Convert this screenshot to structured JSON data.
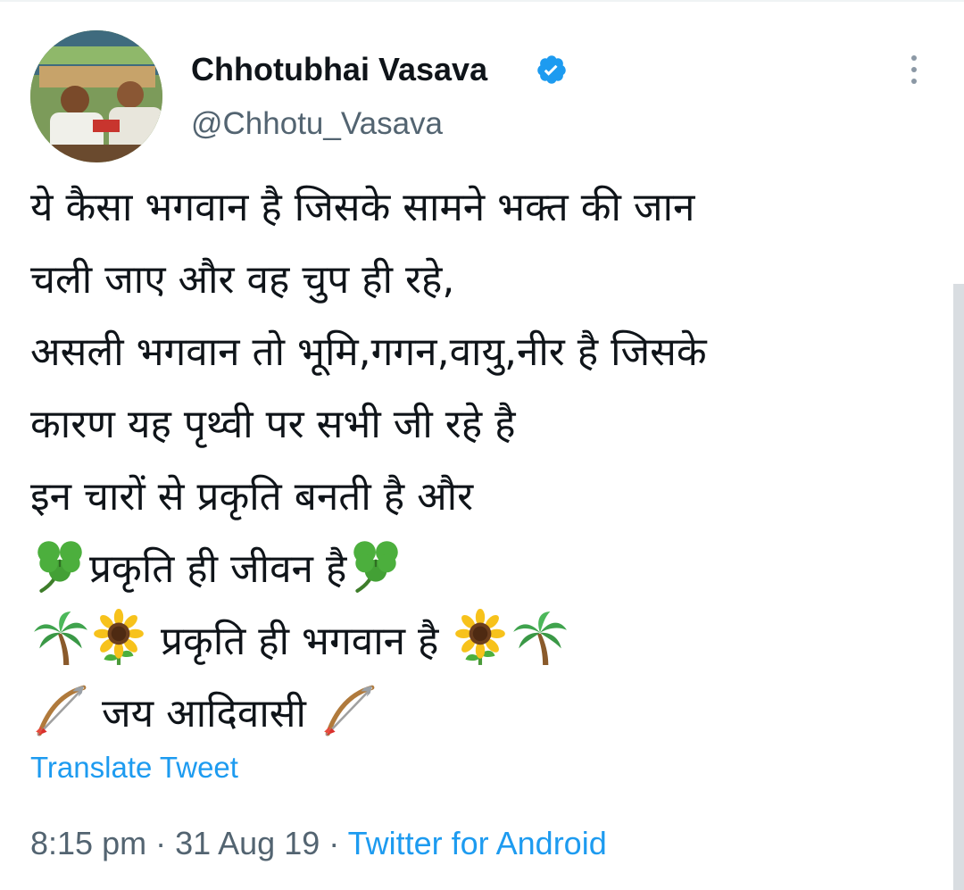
{
  "author": {
    "display_name": "Chhotubhai Vasava",
    "handle": "@Chhotu_Vasava",
    "verified_icon": "verified-badge-icon",
    "avatar_icon": "profile-photo"
  },
  "menu": {
    "more_icon": "more-vertical-icon"
  },
  "tweet": {
    "lines": [
      "ये कैसा भगवान है जिसके सामने भक्त की जान",
      "चली जाए और वह चुप ही रहे,",
      "असली भगवान तो भूमि,गगन,वायु,नीर है जिसके",
      "कारण यह पृथ्वी पर सभी जी रहे है",
      "इन चारों से प्रकृति बनती है और",
      "प्रकृति ही जीवन है",
      " प्रकृति ही भगवान है ",
      " जय आदिवासी "
    ],
    "emoji": {
      "clover": "shamrock-icon",
      "palm": "palm-tree-icon",
      "sunflower": "sunflower-icon",
      "bow": "bow-and-arrow-icon"
    }
  },
  "translate_label": "Translate Tweet",
  "timestamp": {
    "time": "8:15 pm",
    "separator": " · ",
    "date": "31 Aug 19",
    "source": "Twitter for Android"
  },
  "colors": {
    "link": "#1d9bf0",
    "text": "#0f1419",
    "secondary": "#536471"
  }
}
